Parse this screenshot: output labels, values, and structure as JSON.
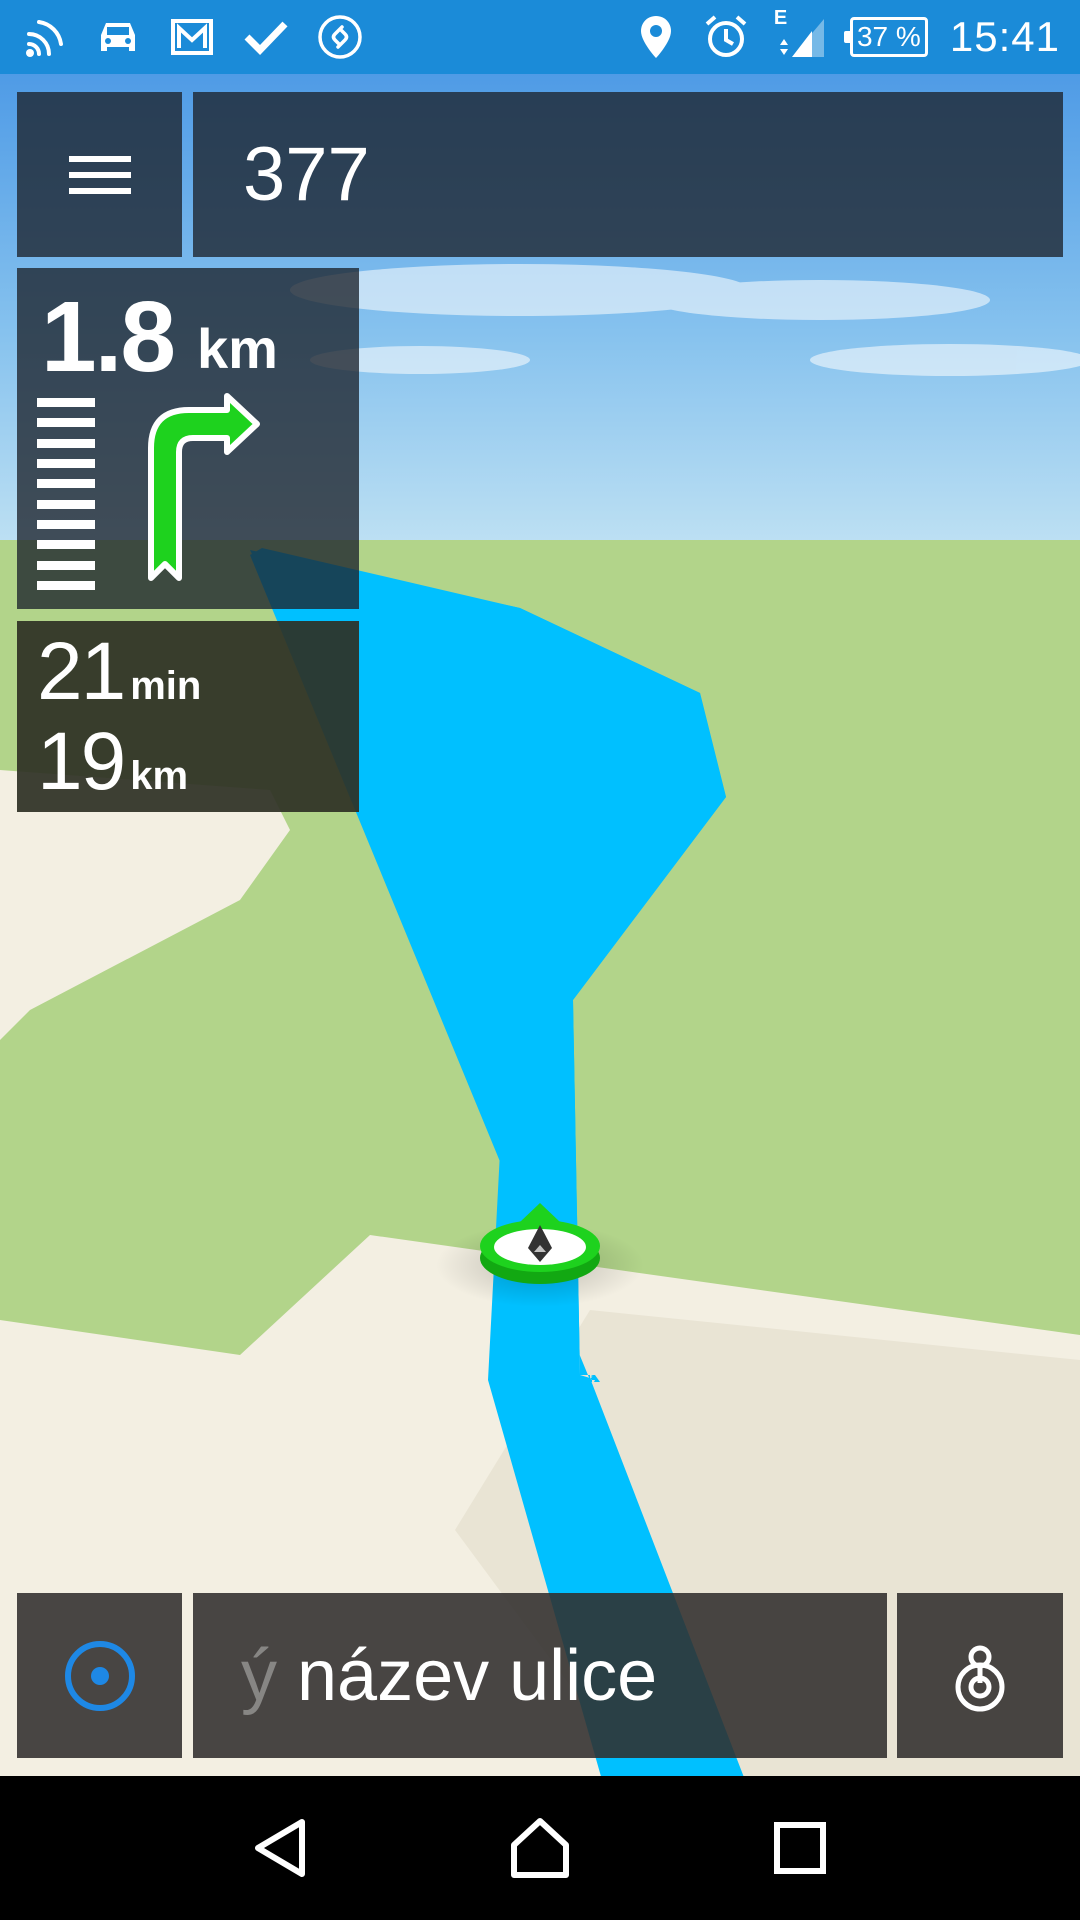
{
  "status_bar": {
    "left_icons": [
      "cast-icon",
      "car-icon",
      "gmail-icon",
      "check-icon",
      "shazam-icon"
    ],
    "right_icons": [
      "location-pin-icon",
      "alarm-icon",
      "signal-icon"
    ],
    "network_label": "E",
    "battery": "37 %",
    "time": "15:41"
  },
  "top": {
    "menu_icon": "hamburger-menu-icon",
    "road_number": "377"
  },
  "maneuver": {
    "distance_value": "1.8",
    "distance_unit": "km",
    "turn": "turn-right-arrow-icon"
  },
  "eta": {
    "time_value": "21",
    "time_unit": "min",
    "distance_value": "19",
    "distance_unit": "km"
  },
  "bottom": {
    "locate_icon": "my-location-icon",
    "street_faded": "ý",
    "street_text": " název ulice",
    "route_icon": "route-options-icon"
  },
  "nav_bar": {
    "icons": [
      "back-icon",
      "home-icon",
      "recents-icon"
    ]
  },
  "colors": {
    "status_bar": "#1b8bd8",
    "route": "#00c0ff",
    "turn_arrow": "#1ed21e",
    "grass": "#b2d48a",
    "land": "#f3efe2"
  }
}
